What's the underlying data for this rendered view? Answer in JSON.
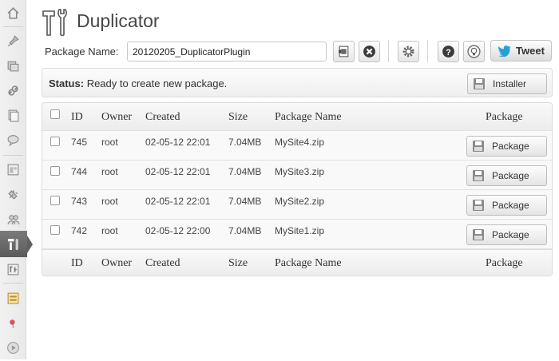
{
  "header": {
    "title": "Duplicator"
  },
  "toolbar": {
    "package_name_label": "Package Name:",
    "package_name_value": "20120205_DuplicatorPlugin",
    "tweet_label": "Tweet",
    "icons": [
      "create-package-icon",
      "delete-icon",
      "settings-gear-icon",
      "help-icon",
      "bulb-icon",
      "twitter-bird-icon"
    ]
  },
  "status": {
    "label": "Status:",
    "message": "Ready to create new package.",
    "installer_label": "Installer"
  },
  "table": {
    "columns": [
      "ID",
      "Owner",
      "Created",
      "Size",
      "Package Name",
      "Package"
    ],
    "rows": [
      {
        "id": "745",
        "owner": "root",
        "created": "02-05-12 22:01",
        "size": "7.04MB",
        "name": "MySite4.zip",
        "action": "Package"
      },
      {
        "id": "744",
        "owner": "root",
        "created": "02-05-12 22:01",
        "size": "7.04MB",
        "name": "MySite3.zip",
        "action": "Package"
      },
      {
        "id": "743",
        "owner": "root",
        "created": "02-05-12 22:01",
        "size": "7.04MB",
        "name": "MySite2.zip",
        "action": "Package"
      },
      {
        "id": "742",
        "owner": "root",
        "created": "02-05-12 22:00",
        "size": "7.04MB",
        "name": "MySite1.zip",
        "action": "Package"
      }
    ]
  },
  "sidebar": {
    "items": [
      "dashboard-icon",
      "posts-pin-icon",
      "media-icon",
      "links-icon",
      "pages-icon",
      "comments-icon",
      "appearance-icon",
      "plugins-icon",
      "users-icon",
      "duplicator-tools-icon",
      "tools-icon",
      "settings-icon",
      "flag-icon",
      "play-icon"
    ],
    "active": "duplicator-tools-icon"
  },
  "colors": {
    "accent_active": "#5b5b5b",
    "delete_red": "#333333",
    "twitter_blue": "#2a9fd6"
  }
}
